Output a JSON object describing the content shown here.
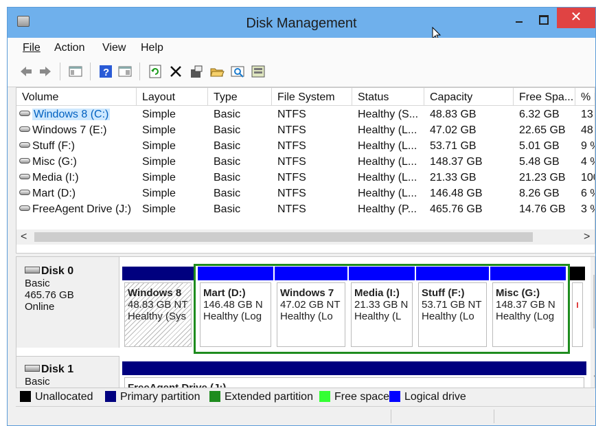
{
  "window": {
    "title": "Disk Management",
    "close_glyph": "✕"
  },
  "menu": [
    "File",
    "Action",
    "View",
    "Help"
  ],
  "toolbar_icons": [
    "back-icon",
    "forward-icon",
    "console-tree-icon",
    "help-icon",
    "properties-view-icon",
    "refresh-icon",
    "delete-icon",
    "properties-icon",
    "open-icon",
    "explore-icon",
    "disk-settings-icon"
  ],
  "columns": [
    "Volume",
    "Layout",
    "Type",
    "File System",
    "Status",
    "Capacity",
    "Free Spa...",
    "% F"
  ],
  "volumes": [
    {
      "volume": "Windows 8 (C:)",
      "layout": "Simple",
      "type": "Basic",
      "fs": "NTFS",
      "status": "Healthy (S...",
      "capacity": "48.83 GB",
      "free": "6.32 GB",
      "pct": "13"
    },
    {
      "volume": "Windows 7 (E:)",
      "layout": "Simple",
      "type": "Basic",
      "fs": "NTFS",
      "status": "Healthy (L...",
      "capacity": "47.02 GB",
      "free": "22.65 GB",
      "pct": "48"
    },
    {
      "volume": "Stuff (F:)",
      "layout": "Simple",
      "type": "Basic",
      "fs": "NTFS",
      "status": "Healthy (L...",
      "capacity": "53.71 GB",
      "free": "5.01 GB",
      "pct": "9 %"
    },
    {
      "volume": "Misc (G:)",
      "layout": "Simple",
      "type": "Basic",
      "fs": "NTFS",
      "status": "Healthy (L...",
      "capacity": "148.37 GB",
      "free": "5.48 GB",
      "pct": "4 %"
    },
    {
      "volume": "Media (I:)",
      "layout": "Simple",
      "type": "Basic",
      "fs": "NTFS",
      "status": "Healthy (L...",
      "capacity": "21.33 GB",
      "free": "21.23 GB",
      "pct": "100"
    },
    {
      "volume": "Mart (D:)",
      "layout": "Simple",
      "type": "Basic",
      "fs": "NTFS",
      "status": "Healthy (L...",
      "capacity": "146.48 GB",
      "free": "8.26 GB",
      "pct": "6 %"
    },
    {
      "volume": "FreeAgent Drive (J:)",
      "layout": "Simple",
      "type": "Basic",
      "fs": "NTFS",
      "status": "Healthy (P...",
      "capacity": "465.76 GB",
      "free": "14.76 GB",
      "pct": "3 %"
    }
  ],
  "disk0": {
    "name": "Disk 0",
    "type": "Basic",
    "size": "465.76 GB",
    "state": "Online",
    "partitions": [
      {
        "name": "Windows 8",
        "size": "48.83 GB NT",
        "status": "Healthy (Sys"
      },
      {
        "name": "Mart  (D:)",
        "size": "146.48 GB N",
        "status": "Healthy (Log"
      },
      {
        "name": "Windows 7",
        "size": "47.02 GB NT",
        "status": "Healthy (Lo"
      },
      {
        "name": "Media  (I:)",
        "size": "21.33 GB N",
        "status": "Healthy (L"
      },
      {
        "name": "Stuff  (F:)",
        "size": "53.71 GB NT",
        "status": "Healthy (Lo"
      },
      {
        "name": "Misc  (G:)",
        "size": "148.37 GB N",
        "status": "Healthy (Log"
      }
    ]
  },
  "disk1": {
    "name": "Disk 1",
    "type": "Basic",
    "partition_name": "FreeAgent Drive  (J:)"
  },
  "legend": [
    {
      "label": "Unallocated",
      "color": "#000000"
    },
    {
      "label": "Primary partition",
      "color": "#00007f"
    },
    {
      "label": "Extended partition",
      "color": "#1e8c1e"
    },
    {
      "label": "Free space",
      "color": "#33ff33"
    },
    {
      "label": "Logical drive",
      "color": "#0000ff"
    }
  ],
  "colors": {
    "primary": "#00007f",
    "logical": "#0000ff",
    "extended": "#1e8c1e",
    "titlebar": "#6fb0ec",
    "close": "#e04343"
  }
}
